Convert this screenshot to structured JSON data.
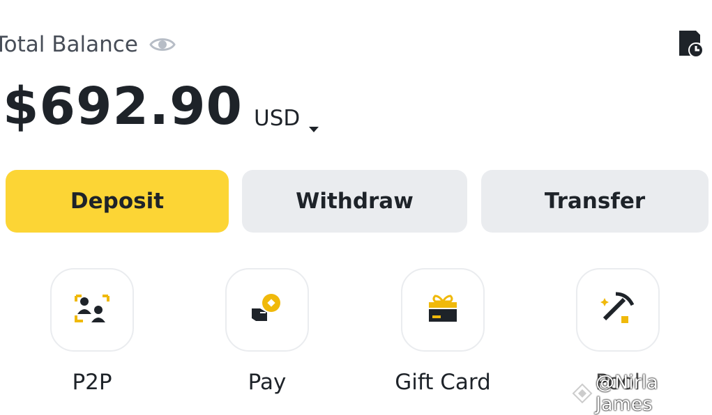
{
  "header": {
    "balance_label": "Total Balance",
    "visibility_icon": "eye-icon",
    "history_icon": "history-clock-icon"
  },
  "balance": {
    "amount": "$692.90",
    "currency": "USD",
    "currency_dropdown_icon": "caret-down-icon"
  },
  "actions": {
    "deposit": "Deposit",
    "withdraw": "Withdraw",
    "transfer": "Transfer"
  },
  "shortcuts": [
    {
      "label": "P2P",
      "icon": "p2p-users-icon"
    },
    {
      "label": "Pay",
      "icon": "pay-hand-coin-icon"
    },
    {
      "label": "Gift Card",
      "icon": "gift-card-icon"
    },
    {
      "label": "Pool",
      "icon": "pickaxe-icon"
    }
  ],
  "watermark": {
    "text": "@Nirla James"
  },
  "colors": {
    "accent": "#fcd535",
    "button_secondary": "#eaecef",
    "text_primary": "#1e2329",
    "text_secondary": "#474d57"
  }
}
